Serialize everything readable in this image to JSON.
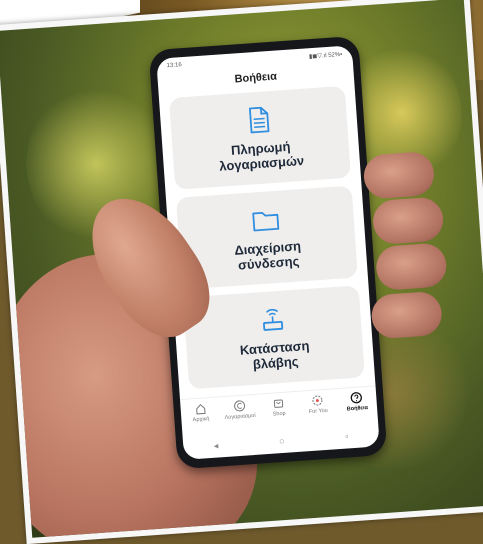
{
  "colors": {
    "tile_background": "#f0eeec",
    "icon_blue": "#2f8ee0",
    "label_dark": "#1e2a3a"
  },
  "status_bar": {
    "time": "13:16",
    "indicators": "▮◼▽.ıl 52%▪"
  },
  "screen": {
    "title": "Βοήθεια"
  },
  "tiles": [
    {
      "label": "Πληρωμή\nλογαριασμών",
      "icon": "document-icon"
    },
    {
      "label": "Διαχείριση\nσύνδεσης",
      "icon": "folder-icon"
    },
    {
      "label": "Κατάσταση\nβλάβης",
      "icon": "router-icon"
    }
  ],
  "tabs": [
    {
      "label": "Αρχική",
      "icon": "home-icon",
      "active": false
    },
    {
      "label": "Λογαριασμοί",
      "icon": "euro-icon",
      "active": false
    },
    {
      "label": "Shop",
      "icon": "cart-icon",
      "active": false
    },
    {
      "label": "For You",
      "icon": "gift-icon",
      "active": false
    },
    {
      "label": "Βοήθεια",
      "icon": "help-icon",
      "active": true
    }
  ],
  "nav_buttons": {
    "back": "◂",
    "home": "○",
    "recents": "▫"
  }
}
